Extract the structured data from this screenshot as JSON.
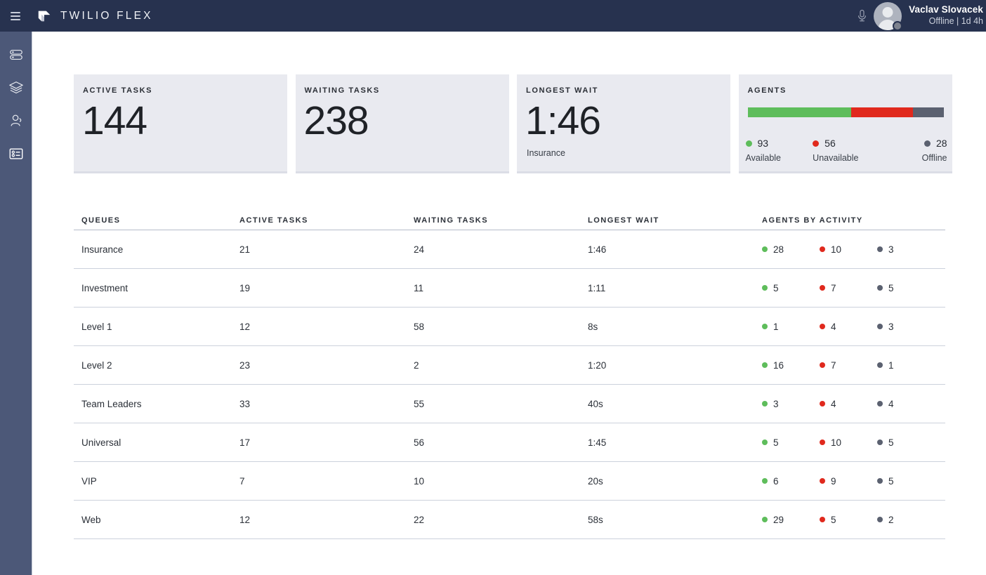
{
  "app": {
    "brand_name": "TWILIO FLEX",
    "menu_icon": "hamburger-icon",
    "logo_icon": "twilio-logo-icon"
  },
  "header": {
    "mic_icon": "microphone-icon",
    "user_name": "Vaclav Slovacek",
    "user_status": "Offline | 1d 4h",
    "presence_color": "#7d828e"
  },
  "sidebar": {
    "items": [
      {
        "name": "sidebar-item-tasks",
        "icon": "tasks-list-icon",
        "active": false
      },
      {
        "name": "sidebar-item-queues",
        "icon": "layers-icon",
        "active": false
      },
      {
        "name": "sidebar-item-agents",
        "icon": "agent-person-icon",
        "active": false
      },
      {
        "name": "sidebar-item-dashboard",
        "icon": "report-card-icon",
        "active": true
      }
    ]
  },
  "cards": [
    {
      "title": "ACTIVE TASKS",
      "value": "144",
      "sub": ""
    },
    {
      "title": "WAITING TASKS",
      "value": "238",
      "sub": ""
    },
    {
      "title": "LONGEST WAIT",
      "value": "1:46",
      "sub": "Insurance"
    }
  ],
  "agents_card": {
    "title": "AGENTS",
    "segments": [
      {
        "label": "Available",
        "count": "93",
        "color": "#5ebd5b"
      },
      {
        "label": "Unavailable",
        "count": "56",
        "color": "#e0291d"
      },
      {
        "label": "Offline",
        "count": "28",
        "color": "#5b6170"
      }
    ]
  },
  "table": {
    "headers": [
      "QUEUES",
      "ACTIVE TASKS",
      "WAITING TASKS",
      "LONGEST WAIT",
      "AGENTS BY ACTIVITY"
    ],
    "rows": [
      {
        "queue": "Insurance",
        "active": "21",
        "waiting": "24",
        "longest": "1:46",
        "available": "28",
        "unavailable": "10",
        "offline": "3"
      },
      {
        "queue": "Investment",
        "active": "19",
        "waiting": "11",
        "longest": "1:11",
        "available": "5",
        "unavailable": "7",
        "offline": "5"
      },
      {
        "queue": "Level 1",
        "active": "12",
        "waiting": "58",
        "longest": "8s",
        "available": "1",
        "unavailable": "4",
        "offline": "3"
      },
      {
        "queue": "Level 2",
        "active": "23",
        "waiting": "2",
        "longest": "1:20",
        "available": "16",
        "unavailable": "7",
        "offline": "1"
      },
      {
        "queue": "Team Leaders",
        "active": "33",
        "waiting": "55",
        "longest": "40s",
        "available": "3",
        "unavailable": "4",
        "offline": "4"
      },
      {
        "queue": "Universal",
        "active": "17",
        "waiting": "56",
        "longest": "1:45",
        "available": "5",
        "unavailable": "10",
        "offline": "5"
      },
      {
        "queue": "VIP",
        "active": "7",
        "waiting": "10",
        "longest": "20s",
        "available": "6",
        "unavailable": "9",
        "offline": "5"
      },
      {
        "queue": "Web",
        "active": "12",
        "waiting": "22",
        "longest": "58s",
        "available": "29",
        "unavailable": "5",
        "offline": "2"
      }
    ]
  },
  "colors": {
    "brand_navy": "#27324f",
    "sidebar": "#4c5878",
    "card_bg": "#e9eaf0",
    "available": "#5ebd5b",
    "unavailable": "#e0291d",
    "offline": "#5b6170"
  }
}
